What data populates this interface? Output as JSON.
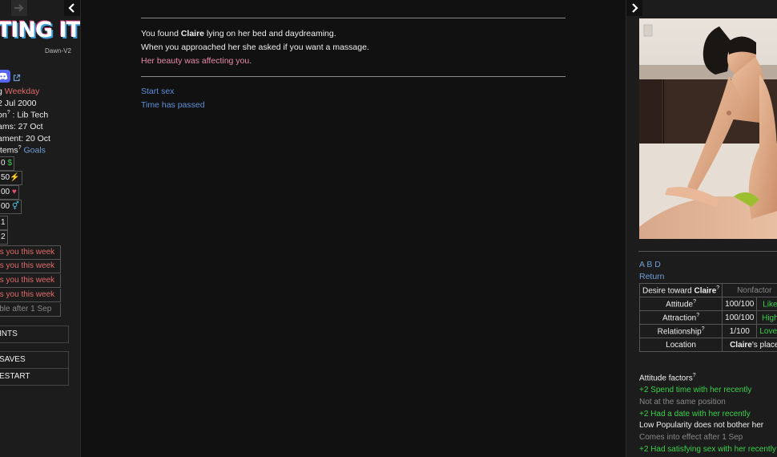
{
  "left": {
    "logo": "TING IT",
    "version": "Dawn-V2",
    "stats_lines": {
      "weekday_prefix": "g",
      "weekday": "Weekday",
      "date": "2 Jul 2000",
      "location_prefix": "on",
      "location_sup": "?",
      "location": " : Lib Tech",
      "exams": "ams: 27 Oct",
      "tournament": "ament: 20 Oct",
      "items_prefix": "Items",
      "items_sup": "?",
      "goals": "Goals"
    },
    "resources": [
      {
        "value": "0",
        "symbol": "$",
        "color": "#3ad14a"
      },
      {
        "value": "50",
        "symbol": "⚡",
        "color": "#e8c33a"
      },
      {
        "value": "00",
        "symbol": "♥",
        "color": "#e64d6f"
      },
      {
        "value": "00",
        "symbol": "⚥",
        "color": "#4dbde6"
      }
    ],
    "small_boxes": [
      "1",
      "2"
    ],
    "effects": [
      "cts you this week",
      "cts you this week",
      "cts you this week",
      "cts you this week",
      "sible after 1 Sep"
    ],
    "buttons": {
      "hints": "INTS",
      "saves": "SAVES",
      "restart": "ESTART"
    }
  },
  "main": {
    "story": {
      "line1_pre": "You found ",
      "line1_name": "Claire",
      "line1_post": " lying on her bed and daydreaming.",
      "line2": "When you approached her she asked if you want a massage.",
      "line3": "Her beauty was affecting you."
    },
    "choices": [
      "Start sex",
      "Time has passed"
    ]
  },
  "right": {
    "links": {
      "abd": "A B D",
      "return": "Return"
    },
    "table": {
      "desire_label": "Desire toward ",
      "desire_name": "Claire",
      "desire_sup": "?",
      "desire_value": "Nonfactor",
      "rows": [
        {
          "label": "Attitude",
          "sup": "?",
          "value": "100/100",
          "status": "Like",
          "status_sup": "?"
        },
        {
          "label": "Attraction",
          "sup": "?",
          "value": "100/100",
          "status": "High",
          "status_sup": "?"
        },
        {
          "label": "Relationship",
          "sup": "?",
          "value": "1/100",
          "status": "Lovers",
          "status_sup": ""
        }
      ],
      "location_label": "Location",
      "location_name": "Claire",
      "location_suffix": "'s place"
    },
    "factors_title": "Attitude factors",
    "factors_title_sup": "?",
    "factors": [
      {
        "text": "+2 Spend time with her recently",
        "color": "#3ad14a"
      },
      {
        "text": "Not at the same position",
        "color": "#888888"
      },
      {
        "text": "+2 Had a date with her recently",
        "color": "#3ad14a"
      },
      {
        "text": "Low Popularity does not bother her",
        "color": "#eeeeee"
      },
      {
        "text": "Comes into effect after 1 Sep",
        "color": "#888888"
      },
      {
        "text": "+2 Had satisfying sex with her recently",
        "color": "#3ad14a"
      }
    ]
  }
}
